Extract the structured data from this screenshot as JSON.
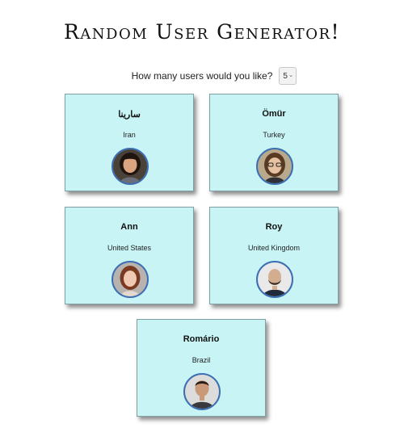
{
  "page": {
    "title": "Random User Generator!"
  },
  "controls": {
    "prompt_label": "How many users would you like?",
    "count_value": "5",
    "count_chevron": "⌄"
  },
  "users": [
    {
      "name": "سارینا",
      "country": "Iran",
      "avatar_icon": "woman-portrait-dark-hair"
    },
    {
      "name": "Ömür",
      "country": "Turkey",
      "avatar_icon": "woman-portrait-glasses"
    },
    {
      "name": "Ann",
      "country": "United States",
      "avatar_icon": "woman-portrait-red-hair"
    },
    {
      "name": "Roy",
      "country": "United Kingdom",
      "avatar_icon": "man-portrait-beard"
    },
    {
      "name": "Romário",
      "country": "Brazil",
      "avatar_icon": "man-portrait-short-hair"
    }
  ],
  "colors": {
    "card_background": "#c8f4f5",
    "avatar_border": "#3a6fb5"
  }
}
